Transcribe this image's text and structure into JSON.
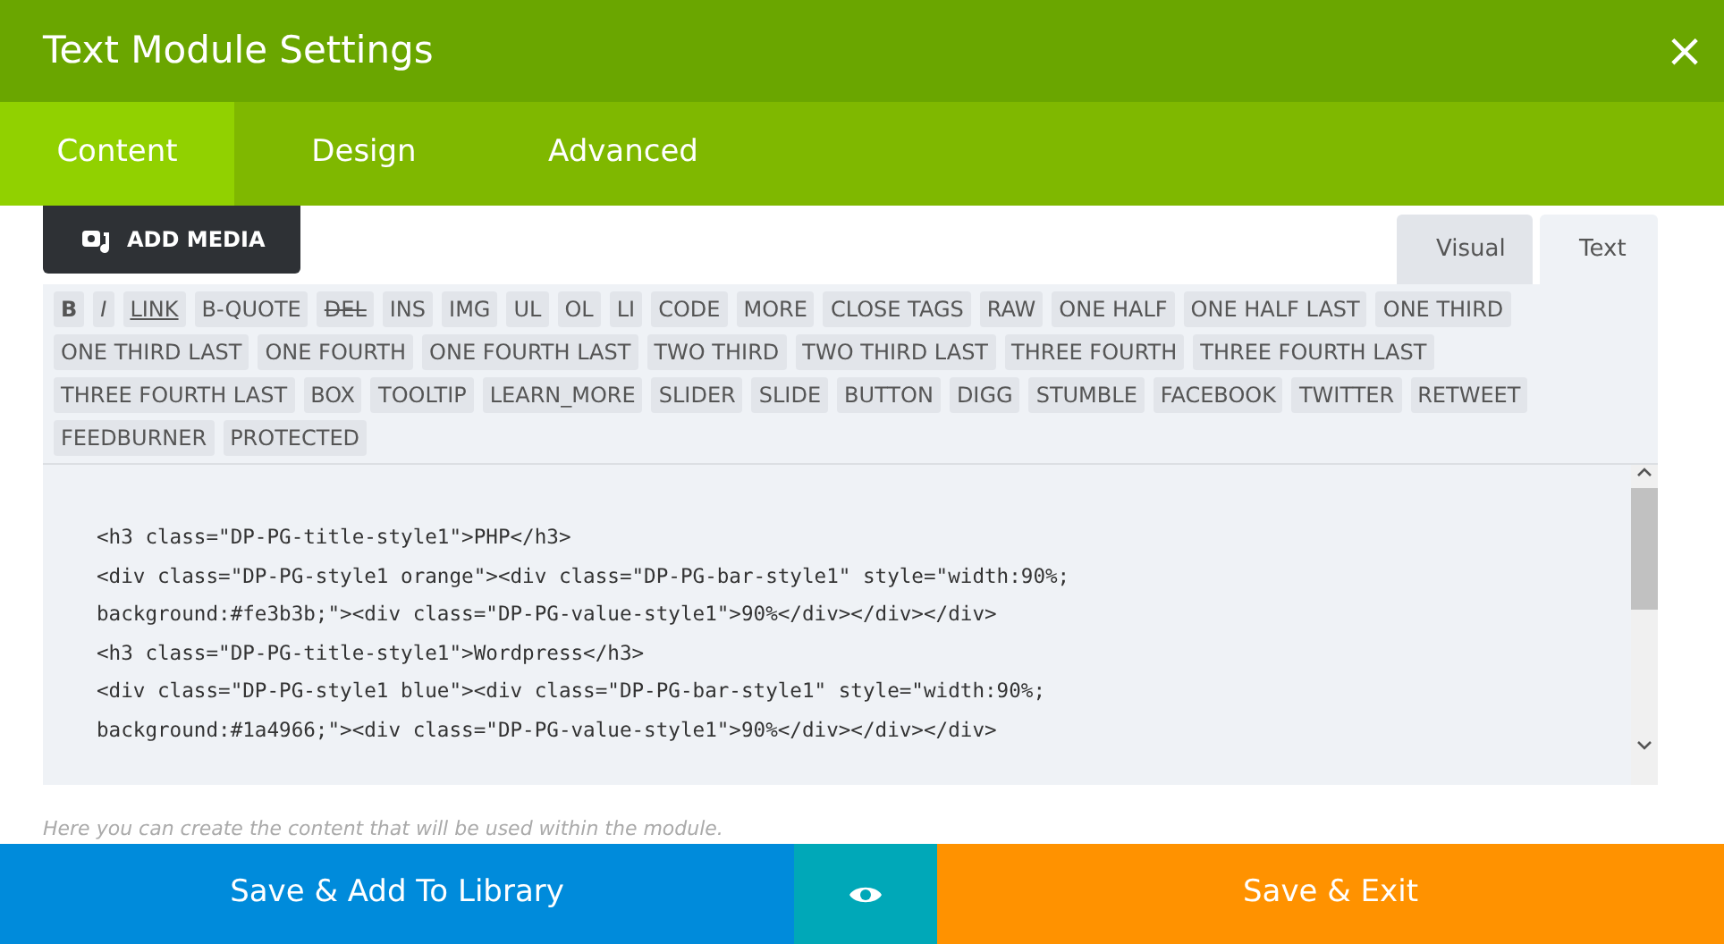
{
  "window": {
    "title": "Text Module Settings",
    "close": "×"
  },
  "tabs": [
    {
      "label": "Content",
      "selected": true
    },
    {
      "label": "Design",
      "selected": false
    },
    {
      "label": "Advanced",
      "selected": false
    }
  ],
  "add_media": {
    "label": "ADD MEDIA"
  },
  "editor_tabs": [
    {
      "label": "Visual",
      "selected": false
    },
    {
      "label": "Text",
      "selected": true
    }
  ],
  "quicktags": [
    {
      "label": "B",
      "kind": "bold"
    },
    {
      "label": "I",
      "kind": "italic"
    },
    {
      "label": "LINK",
      "kind": "link"
    },
    {
      "label": "B-QUOTE",
      "kind": "plain"
    },
    {
      "label": "DEL",
      "kind": "strike"
    },
    {
      "label": "INS",
      "kind": "plain"
    },
    {
      "label": "IMG",
      "kind": "plain"
    },
    {
      "label": "UL",
      "kind": "plain"
    },
    {
      "label": "OL",
      "kind": "plain"
    },
    {
      "label": "LI",
      "kind": "plain"
    },
    {
      "label": "CODE",
      "kind": "plain"
    },
    {
      "label": "MORE",
      "kind": "plain"
    },
    {
      "label": "CLOSE TAGS",
      "kind": "plain"
    },
    {
      "label": "RAW",
      "kind": "plain"
    },
    {
      "label": "ONE HALF",
      "kind": "plain"
    },
    {
      "label": "ONE HALF LAST",
      "kind": "plain"
    },
    {
      "label": "ONE THIRD",
      "kind": "plain"
    },
    {
      "label": "ONE THIRD LAST",
      "kind": "plain"
    },
    {
      "label": "ONE FOURTH",
      "kind": "plain"
    },
    {
      "label": "ONE FOURTH LAST",
      "kind": "plain"
    },
    {
      "label": "TWO THIRD",
      "kind": "plain"
    },
    {
      "label": "TWO THIRD LAST",
      "kind": "plain"
    },
    {
      "label": "THREE FOURTH",
      "kind": "plain"
    },
    {
      "label": "THREE FOURTH LAST",
      "kind": "plain"
    },
    {
      "label": "THREE FOURTH LAST",
      "kind": "plain"
    },
    {
      "label": "BOX",
      "kind": "plain"
    },
    {
      "label": "TOOLTIP",
      "kind": "plain"
    },
    {
      "label": "LEARN_MORE",
      "kind": "plain"
    },
    {
      "label": "SLIDER",
      "kind": "plain"
    },
    {
      "label": "SLIDE",
      "kind": "plain"
    },
    {
      "label": "BUTTON",
      "kind": "plain"
    },
    {
      "label": "DIGG",
      "kind": "plain"
    },
    {
      "label": "STUMBLE",
      "kind": "plain"
    },
    {
      "label": "FACEBOOK",
      "kind": "plain"
    },
    {
      "label": "TWITTER",
      "kind": "plain"
    },
    {
      "label": "RETWEET",
      "kind": "plain"
    },
    {
      "label": "FEEDBURNER",
      "kind": "plain"
    },
    {
      "label": "PROTECTED",
      "kind": "plain"
    }
  ],
  "code_lines": [
    "<h3 class=\"DP-PG-title-style1\">PHP</h3>",
    "<div class=\"DP-PG-style1 orange\"><div class=\"DP-PG-bar-style1\" style=\"width:90%;",
    "background:#fe3b3b;\"><div class=\"DP-PG-value-style1\">90%</div></div></div>",
    "<h3 class=\"DP-PG-title-style1\">Wordpress</h3>",
    "<div class=\"DP-PG-style1 blue\"><div class=\"DP-PG-bar-style1\" style=\"width:90%;",
    "background:#1a4966;\"><div class=\"DP-PG-value-style1\">90%</div></div></div>"
  ],
  "help_text": "Here you can create the content that will be used within the module.",
  "footer": {
    "save_library": "Save & Add To Library",
    "save_exit": "Save & Exit"
  }
}
